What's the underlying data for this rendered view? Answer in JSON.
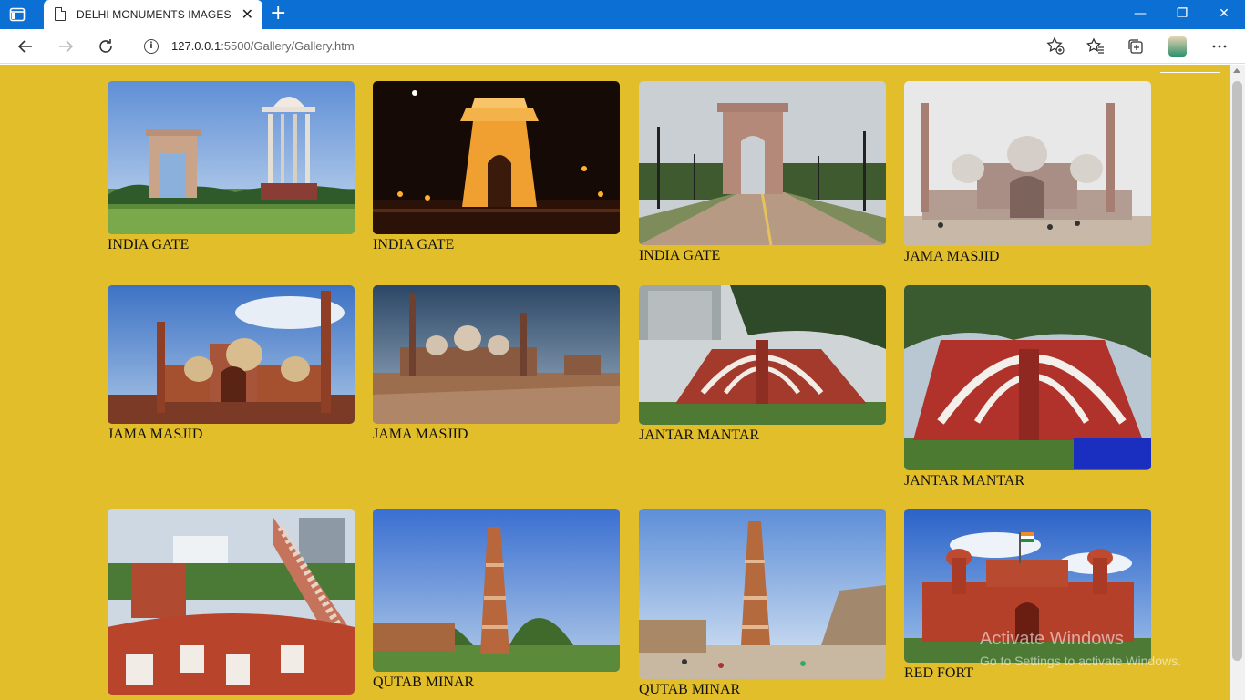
{
  "browser": {
    "tab_title": "DELHI MONUMENTS IMAGES",
    "tab_close": "✕",
    "new_tab": "+",
    "url_host": "127.0.0.1",
    "url_path": ":5500/Gallery/Gallery.htm",
    "window_controls": [
      "—",
      "❐",
      "✕"
    ]
  },
  "gallery": {
    "cards": [
      {
        "caption": "INDIA GATE",
        "scene": "india-gate-day"
      },
      {
        "caption": "INDIA GATE",
        "scene": "india-gate-night"
      },
      {
        "caption": "INDIA GATE",
        "scene": "india-gate-road"
      },
      {
        "caption": "JAMA MASJID",
        "scene": "jama-masjid-haze"
      },
      {
        "caption": "JAMA MASJID",
        "scene": "jama-masjid-front"
      },
      {
        "caption": "JAMA MASJID",
        "scene": "jama-masjid-courtyard"
      },
      {
        "caption": "JANTAR MANTAR",
        "scene": "jantar-mantar-1"
      },
      {
        "caption": "JANTAR MANTAR",
        "scene": "jantar-mantar-2"
      },
      {
        "caption": "",
        "scene": "jantar-mantar-3"
      },
      {
        "caption": "QUTAB MINAR",
        "scene": "qutab-minar-1"
      },
      {
        "caption": "QUTAB MINAR",
        "scene": "qutab-minar-2"
      },
      {
        "caption": "RED FORT",
        "scene": "red-fort"
      }
    ]
  },
  "os_watermark": {
    "line1": "Activate Windows",
    "line2": "Go to Settings to activate Windows."
  },
  "colors": {
    "page_background": "#e2be2a",
    "titlebar": "#0b6fd3"
  }
}
